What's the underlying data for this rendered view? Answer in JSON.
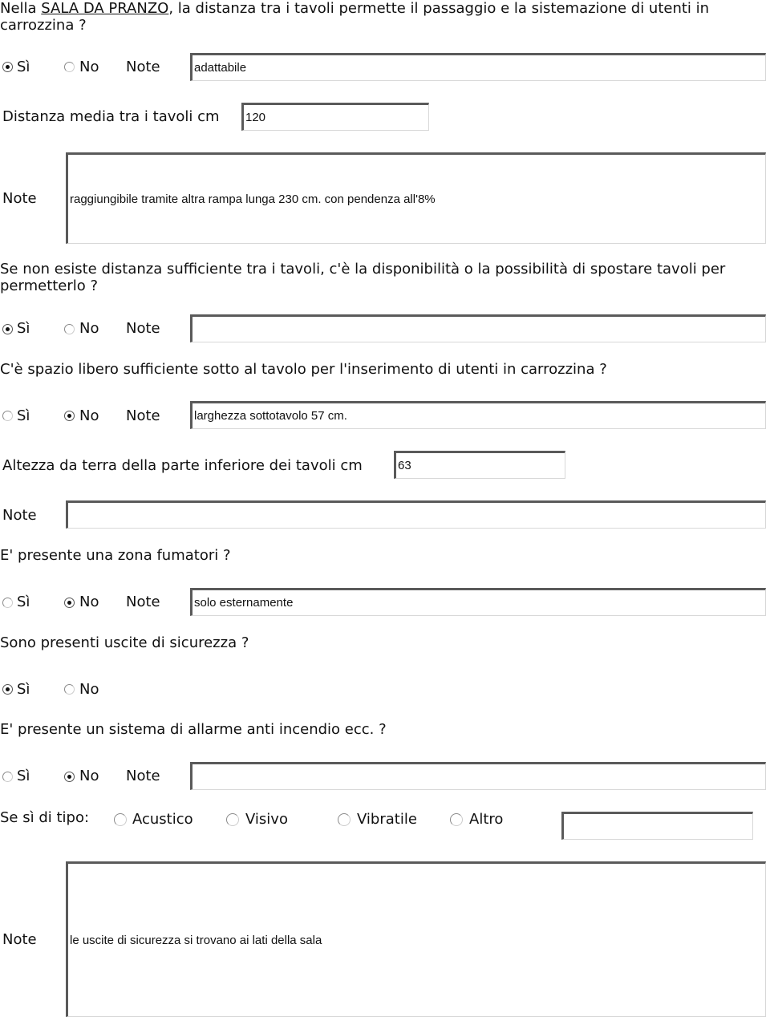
{
  "common": {
    "si": "Sì",
    "no": "No",
    "note": "Note"
  },
  "q1": {
    "prefix": "Nella ",
    "link": "SALA DA PRANZO",
    "rest": ", la distanza tra i tavoli permette il passaggio e la sistemazione di utenti in carrozzina ?",
    "selected": "si",
    "note_value": "adattabile"
  },
  "distance": {
    "label": "Distanza media tra i tavoli cm",
    "value": "120"
  },
  "distance_note": {
    "label": "Note",
    "value": "raggiungibile tramite altra rampa lunga 230 cm. con pendenza all'8%"
  },
  "q2": {
    "text": "Se non esiste distanza sufficiente tra i tavoli, c'è la disponibilità o la possibilità di spostare tavoli per permetterlo ?",
    "selected": "si",
    "note_value": ""
  },
  "q3": {
    "text": "C'è spazio libero sufficiente sotto al tavolo per l'inserimento di utenti in carrozzina ?",
    "selected": "no",
    "note_value": "larghezza sottotavolo 57 cm."
  },
  "height": {
    "label": "Altezza da terra della parte inferiore dei tavoli cm",
    "value": "63"
  },
  "height_note": {
    "label": "Note",
    "value": ""
  },
  "q4": {
    "text": "E' presente una zona fumatori ?",
    "selected": "no",
    "note_value": "solo esternamente"
  },
  "q5": {
    "text": "Sono presenti uscite di sicurezza ?",
    "selected": "si"
  },
  "q6": {
    "text": "E' presente un sistema di allarme anti incendio ecc. ?",
    "selected": "no",
    "note_value": ""
  },
  "alarm_type": {
    "label": "Se sì di tipo:",
    "options": [
      "Acustico",
      "Visivo",
      "Vibratile",
      "Altro"
    ],
    "altro_value": ""
  },
  "final_note": {
    "label": "Note",
    "value": "le uscite di sicurezza si trovano ai lati della sala"
  }
}
